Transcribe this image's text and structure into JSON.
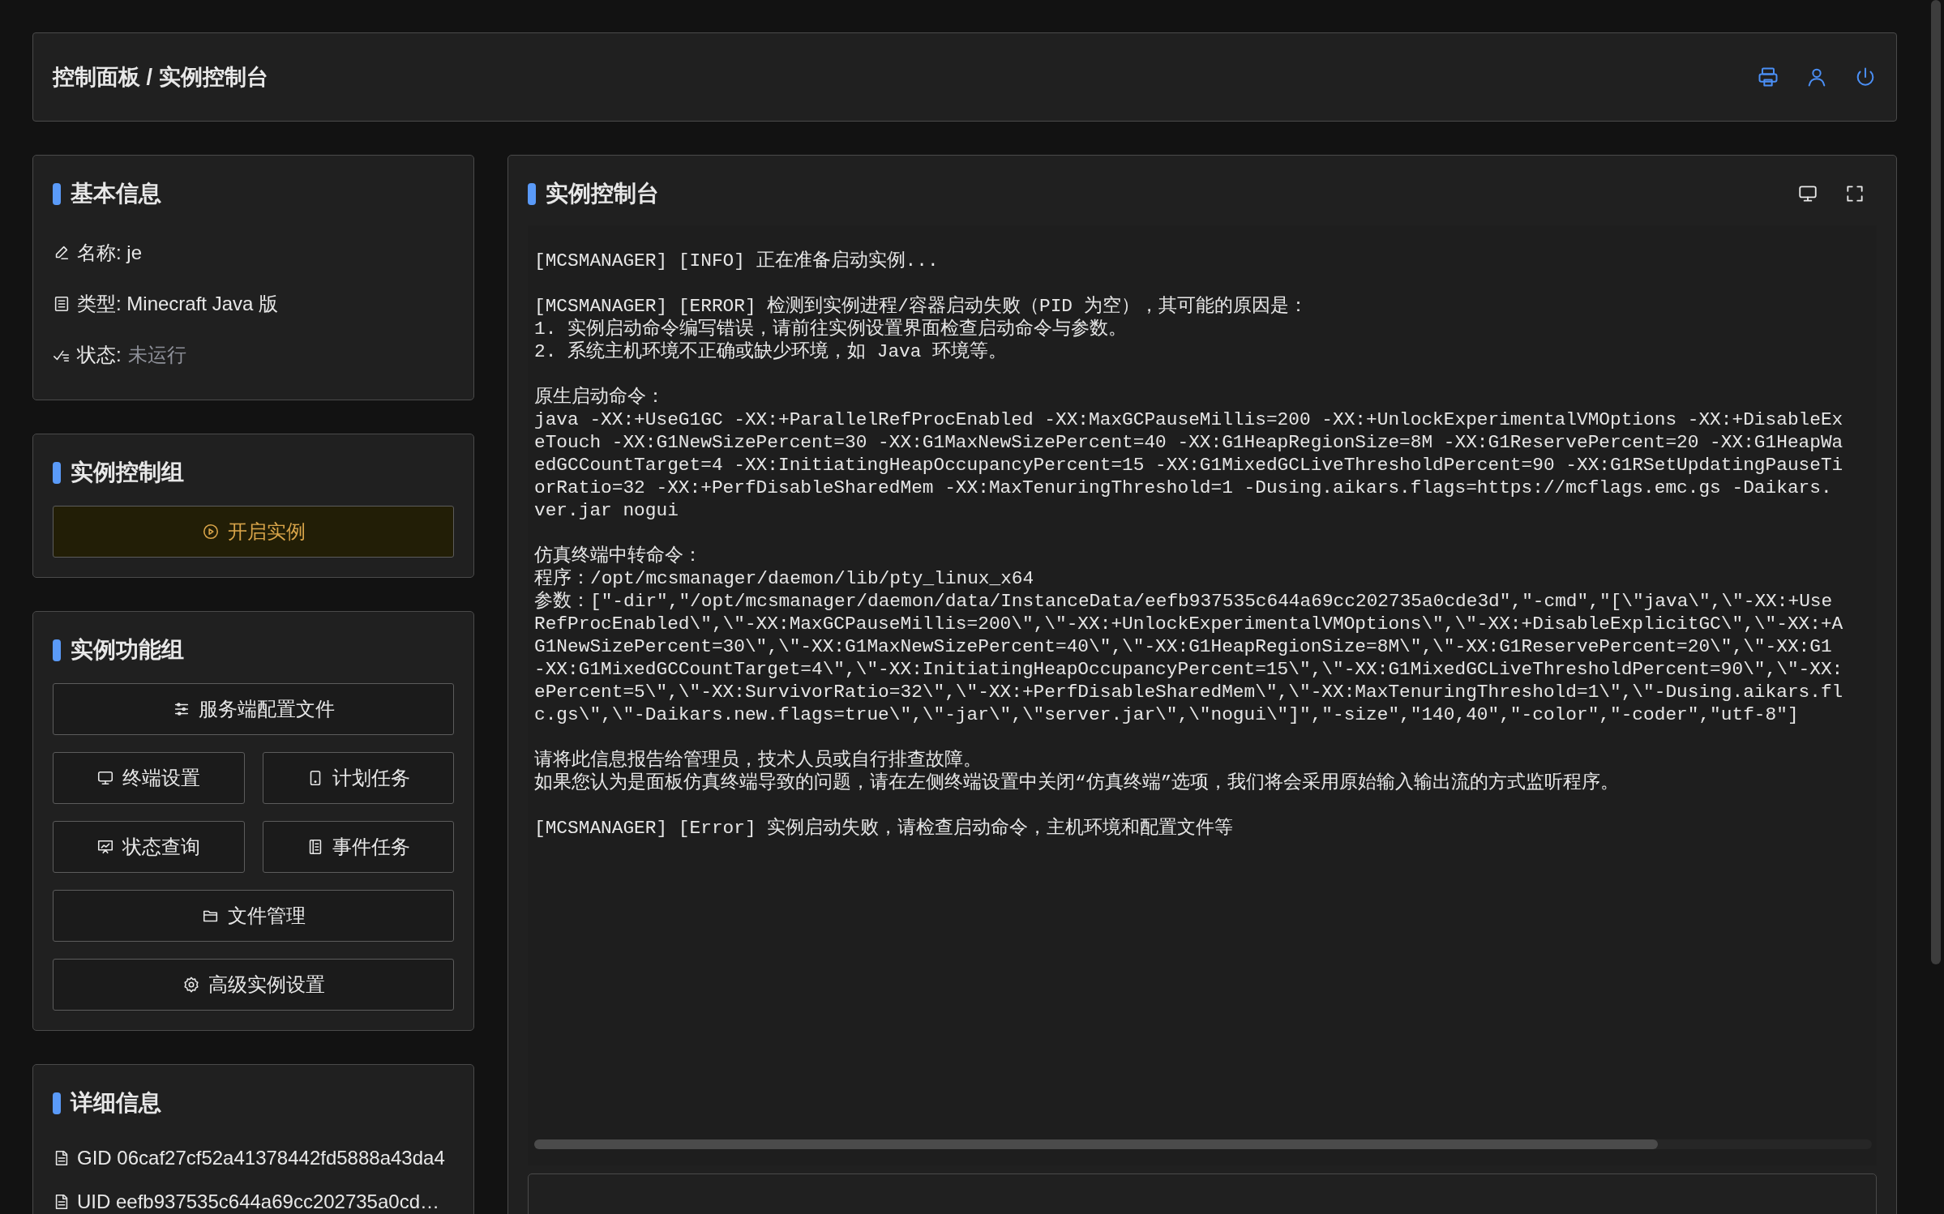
{
  "header": {
    "breadcrumb": "控制面板 / 实例控制台"
  },
  "basic_info": {
    "title": "基本信息",
    "name": "名称: je",
    "type": "类型: Minecraft Java 版",
    "status_label": "状态: ",
    "status": "未运行",
    "running": false
  },
  "control_group": {
    "title": "实例控制组",
    "buttons": [
      {
        "label": "开启实例",
        "kind": "start"
      }
    ]
  },
  "function_group": {
    "title": "实例功能组",
    "buttons": [
      {
        "label": "服务端配置文件"
      },
      {
        "label": "终端设置"
      },
      {
        "label": "计划任务"
      },
      {
        "label": "状态查询"
      },
      {
        "label": "事件任务"
      },
      {
        "label": "文件管理"
      },
      {
        "label": "高级实例设置"
      }
    ]
  },
  "details": {
    "title": "详细信息",
    "rows": [
      "GID 06caf27cf52a41378442fd5888a43da4",
      "UID eefb937535c644a69cc202735a0cd…"
    ]
  },
  "console": {
    "title": "实例控制台",
    "blocks": [
      [
        "[MCSMANAGER] [INFO] 正在准备启动实例..."
      ],
      [
        "[MCSMANAGER] [ERROR] 检测到实例进程/容器启动失败（PID 为空），其可能的原因是：",
        "1. 实例启动命令编写错误，请前往实例设置界面检查启动命令与参数。",
        "2. 系统主机环境不正确或缺少环境，如 Java 环境等。"
      ],
      [
        "原生启动命令：",
        "java -XX:+UseG1GC -XX:+ParallelRefProcEnabled -XX:MaxGCPauseMillis=200 -XX:+UnlockExperimentalVMOptions -XX:+DisableEx",
        "eTouch -XX:G1NewSizePercent=30 -XX:G1MaxNewSizePercent=40 -XX:G1HeapRegionSize=8M -XX:G1ReservePercent=20 -XX:G1HeapWa",
        "edGCCountTarget=4 -XX:InitiatingHeapOccupancyPercent=15 -XX:G1MixedGCLiveThresholdPercent=90 -XX:G1RSetUpdatingPauseTi",
        "orRatio=32 -XX:+PerfDisableSharedMem -XX:MaxTenuringThreshold=1 -Dusing.aikars.flags=https://mcflags.emc.gs -Daikars.",
        "ver.jar nogui"
      ],
      [
        "仿真终端中转命令：",
        "程序：/opt/mcsmanager/daemon/lib/pty_linux_x64",
        "参数：[\"-dir\",\"/opt/mcsmanager/daemon/data/InstanceData/eefb937535c644a69cc202735a0cde3d\",\"-cmd\",\"[\\\"java\\\",\\\"-XX:+Use",
        "RefProcEnabled\\\",\\\"-XX:MaxGCPauseMillis=200\\\",\\\"-XX:+UnlockExperimentalVMOptions\\\",\\\"-XX:+DisableExplicitGC\\\",\\\"-XX:+A",
        "G1NewSizePercent=30\\\",\\\"-XX:G1MaxNewSizePercent=40\\\",\\\"-XX:G1HeapRegionSize=8M\\\",\\\"-XX:G1ReservePercent=20\\\",\\\"-XX:G1",
        "-XX:G1MixedGCCountTarget=4\\\",\\\"-XX:InitiatingHeapOccupancyPercent=15\\\",\\\"-XX:G1MixedGCLiveThresholdPercent=90\\\",\\\"-XX:",
        "ePercent=5\\\",\\\"-XX:SurvivorRatio=32\\\",\\\"-XX:+PerfDisableSharedMem\\\",\\\"-XX:MaxTenuringThreshold=1\\\",\\\"-Dusing.aikars.fl",
        "c.gs\\\",\\\"-Daikars.new.flags=true\\\",\\\"-jar\\\",\\\"server.jar\\\",\\\"nogui\\\"]\",\"-size\",\"140,40\",\"-color\",\"-coder\",\"utf-8\"]"
      ],
      [
        "请将此信息报告给管理员，技术人员或自行排查故障。",
        "如果您认为是面板仿真终端导致的问题，请在左侧终端设置中关闭“仿真终端”选项，我们将会采用原始输入输出流的方式监听程序。"
      ],
      [
        "[MCSMANAGER] [Error] 实例启动失败，请检查启动命令，主机环境和配置文件等"
      ]
    ]
  }
}
